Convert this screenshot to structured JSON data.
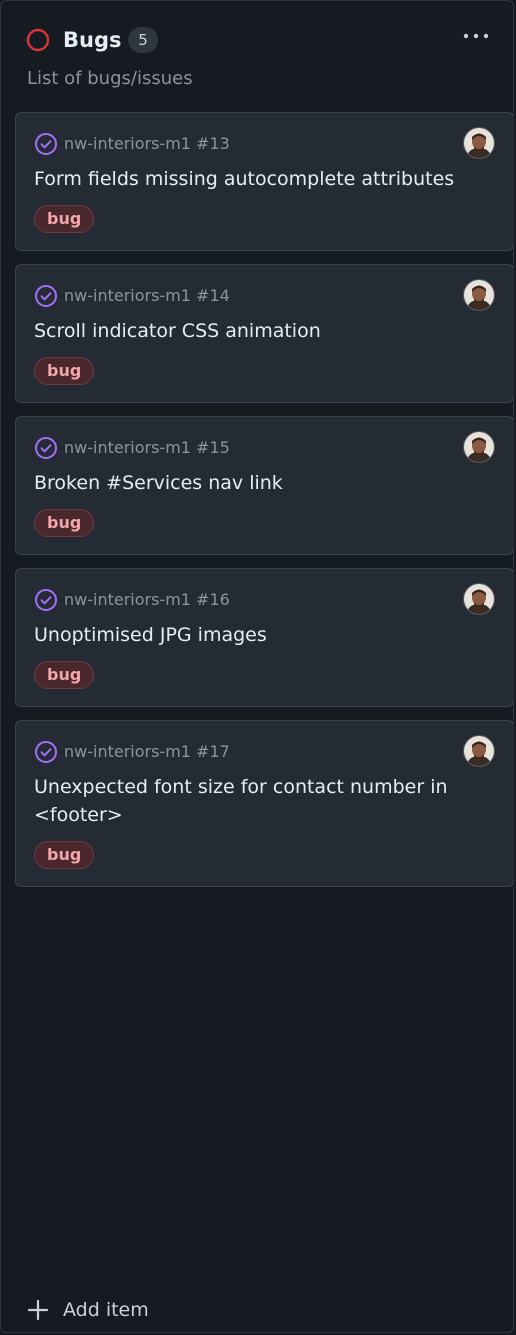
{
  "column": {
    "title": "Bugs",
    "count": "5",
    "description": "List of bugs/issues",
    "status_color": "#da3633",
    "more_icon": "kebab-horizontal-icon"
  },
  "cards": [
    {
      "repo": "nw-interiors-m1 #13",
      "title": "Form fields missing autocomplete attributes",
      "label": "bug"
    },
    {
      "repo": "nw-interiors-m1 #14",
      "title": "Scroll indicator CSS animation",
      "label": "bug"
    },
    {
      "repo": "nw-interiors-m1 #15",
      "title": "Broken #Services nav link",
      "label": "bug"
    },
    {
      "repo": "nw-interiors-m1 #16",
      "title": "Unoptimised JPG images",
      "label": "bug"
    },
    {
      "repo": "nw-interiors-m1 #17",
      "title": "Unexpected font size for contact number in <footer>",
      "label": "bug"
    }
  ],
  "footer": {
    "add_label": "Add item",
    "add_icon": "plus-icon"
  },
  "colors": {
    "background": "#161a21",
    "card": "#252b35",
    "closed_issue": "#a371f7",
    "bug_label_bg": "#49272c",
    "bug_label_text": "#f2a6ab"
  }
}
